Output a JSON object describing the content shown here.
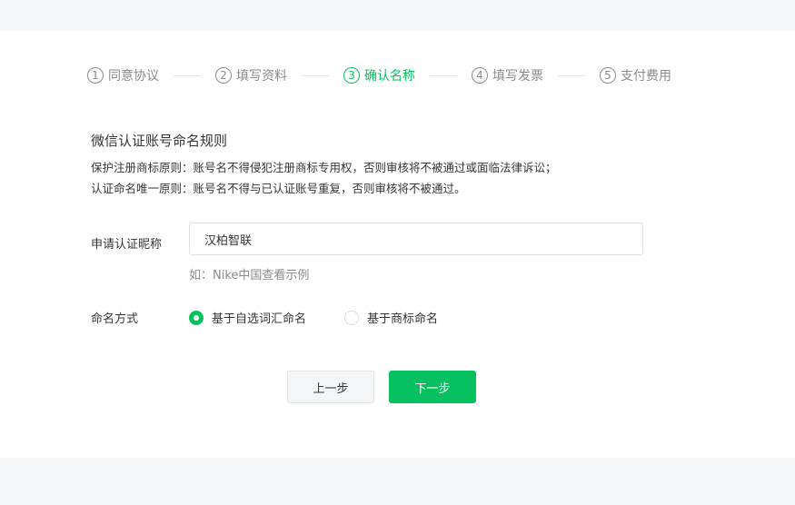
{
  "stepper": {
    "steps": [
      {
        "number": "1",
        "label": "同意协议",
        "state": "done"
      },
      {
        "number": "2",
        "label": "填写资料",
        "state": "done"
      },
      {
        "number": "3",
        "label": "确认名称",
        "state": "active"
      },
      {
        "number": "4",
        "label": "填写发票",
        "state": "pending"
      },
      {
        "number": "5",
        "label": "支付费用",
        "state": "pending"
      }
    ]
  },
  "rules": {
    "title": "微信认证账号命名规则",
    "items": [
      "保护注册商标原则：账号名不得侵犯注册商标专用权，否则审核将不被通过或面临法律诉讼；",
      "认证命名唯一原则：账号名不得与已认证账号重复，否则审核将不被通过。"
    ]
  },
  "form": {
    "nickname_label": "申请认证昵称",
    "nickname_value": "汉柏智联",
    "hint_prefix": "如：Nike中国",
    "hint_link": "查看示例",
    "method_label": "命名方式",
    "method_options": [
      {
        "label": "基于自选词汇命名",
        "checked": true
      },
      {
        "label": "基于商标命名",
        "checked": false
      }
    ]
  },
  "actions": {
    "prev_label": "上一步",
    "next_label": "下一步"
  },
  "colors": {
    "accent": "#07c160",
    "page_bg": "#f4f5f7",
    "card_bg": "#ffffff",
    "muted_text": "#8a8a8a"
  }
}
